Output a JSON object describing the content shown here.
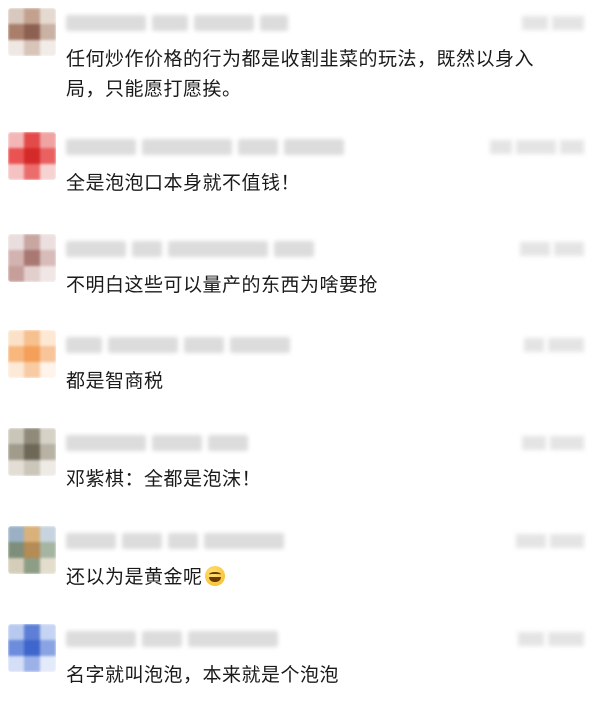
{
  "comments": [
    {
      "text_lines": [
        "任何炒作价格的行为都是收割韭菜的玩法，既然以身入",
        "局，只能愿打愿挨。"
      ],
      "avatar_colors": [
        "#d8c8be",
        "#c4a18f",
        "#e6d9d0",
        "#a97f6b",
        "#8d6152",
        "#c9b1a4",
        "#efe7e2",
        "#d9c4b9",
        "#f2ece8"
      ]
    },
    {
      "text": "全是泡泡口本身就不值钱！",
      "avatar_colors": [
        "#f3b6b6",
        "#e34a4a",
        "#f0a3a3",
        "#e95353",
        "#d42a2a",
        "#ea6161",
        "#f5c2c2",
        "#ec6c6c",
        "#f7d2d2"
      ]
    },
    {
      "text": "不明白这些可以量产的东西为啥要抢",
      "avatar_colors": [
        "#e9dddd",
        "#c8a6a2",
        "#ecdfdf",
        "#d2b3b0",
        "#a97873",
        "#d7bcb9",
        "#c69e9a",
        "#e2cfcd",
        "#f0e6e5"
      ]
    },
    {
      "text": "都是智商税",
      "avatar_colors": [
        "#fbe1c8",
        "#f7c08f",
        "#fde8d4",
        "#f7b77d",
        "#f4a05a",
        "#f8c49a",
        "#fde9d8",
        "#f9cba4",
        "#fff3ea"
      ]
    },
    {
      "text": "邓紫棋：全都是泡沫！",
      "avatar_colors": [
        "#c9c5b8",
        "#8f8a79",
        "#d6d2c8",
        "#a09b8b",
        "#6e6858",
        "#b7b2a4",
        "#e2ded6",
        "#cbc6ba",
        "#eeebe6"
      ]
    },
    {
      "text": "还以为是黄金呢",
      "emoji": "laughing-tears",
      "avatar_colors": [
        "#9bb0c4",
        "#d8b27a",
        "#c7d4e0",
        "#7d8f7a",
        "#b58b56",
        "#a6b5a2",
        "#d4cdb9",
        "#8e9e86",
        "#e3ddcc"
      ]
    },
    {
      "text": "名字就叫泡泡，本来就是个泡泡",
      "avatar_colors": [
        "#b7c9ef",
        "#5d7fd6",
        "#c6d4f3",
        "#6c8cdc",
        "#3f66cc",
        "#8aa3e3",
        "#d4def6",
        "#9bb1e8",
        "#e3eaf9"
      ]
    }
  ]
}
